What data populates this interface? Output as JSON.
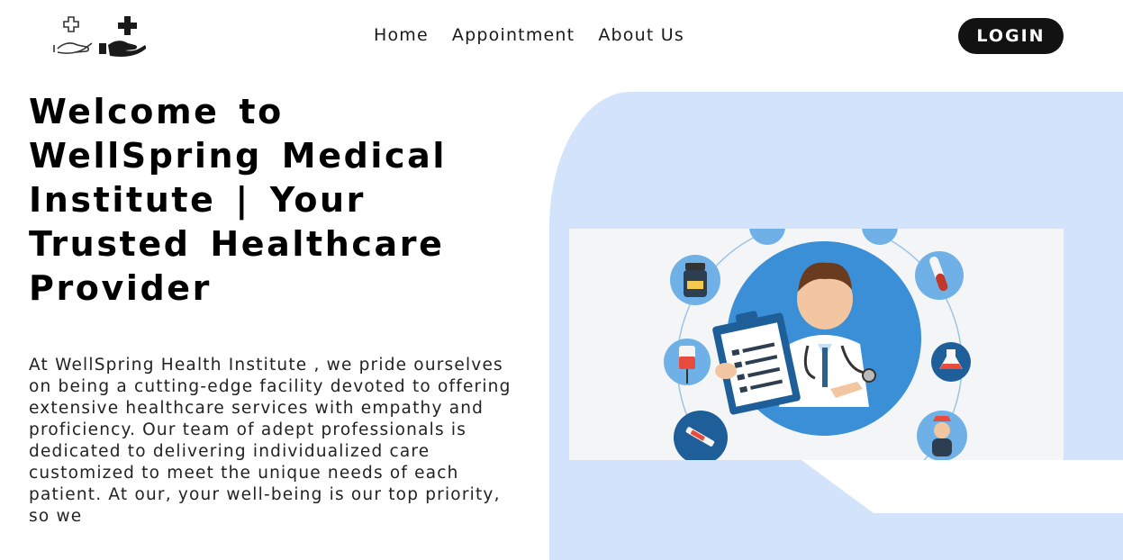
{
  "header": {
    "logo": {
      "icon": "hand-medical-cross-icons"
    },
    "nav": [
      {
        "label": "Home"
      },
      {
        "label": "Appointment"
      },
      {
        "label": "About Us"
      }
    ],
    "login_label": "LOGIN"
  },
  "hero": {
    "title": "Welcome to WellSpring Medical Institute | Your Trusted Healthcare Provider",
    "description": "At WellSpring Health Institute , we pride ourselves on being a cutting-edge facility devoted to offering extensive healthcare services with empathy and proficiency. Our team of adept professionals is dedicated to delivering individualized care customized to meet the unique needs of each patient. At our, your well-being is our top priority, so we",
    "illustration": {
      "icon": "doctor-with-clipboard-illustration"
    }
  },
  "colors": {
    "hero_background": "#d3e3fb",
    "login_background": "#121212",
    "accent_blue": "#3f8fd6"
  }
}
